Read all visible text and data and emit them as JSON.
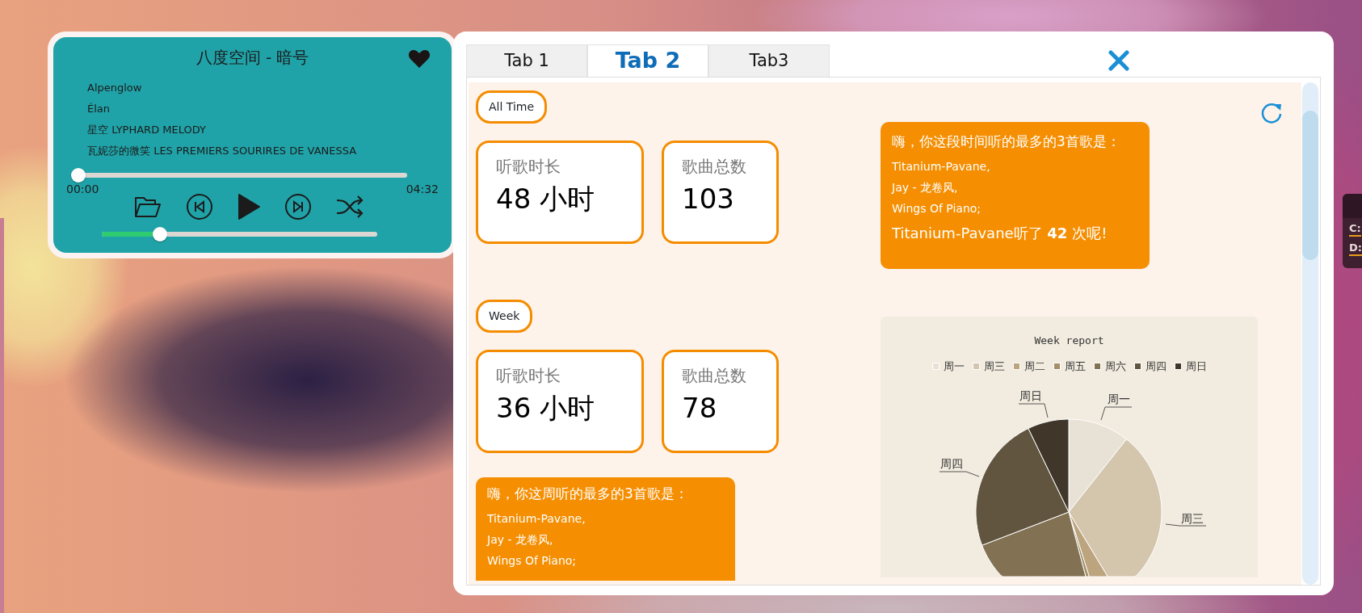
{
  "player": {
    "title": "八度空间 - 暗号",
    "liked": true,
    "playlist": [
      "Alpenglow",
      "Élan",
      "星空 LYPHARD MELODY",
      "瓦妮莎的微笑 LES PREMIERS SOURIRES DE VANESSA"
    ],
    "progress": {
      "level": 0
    },
    "elapsed": "00:00",
    "duration": "04:32",
    "playing": false,
    "volume": {
      "level": 0.21
    }
  },
  "window": {
    "tabs": [
      {
        "label": "Tab 1",
        "selected": false
      },
      {
        "label": "Tab 2",
        "selected": true
      },
      {
        "label": "Tab3",
        "selected": false
      }
    ]
  },
  "sections": [
    {
      "label": "All Time",
      "cards": [
        {
          "label": "听歌时长",
          "value": "48 小时"
        },
        {
          "label": "歌曲总数",
          "value": "103"
        }
      ],
      "message": {
        "heading": "嗨，你这段时间听的最多的3首歌是：",
        "songs": [
          "Titanium-Pavane,",
          "Jay - 龙卷风,",
          "Wings Of Piano;"
        ],
        "summary": "Titanium-Pavane听了 **42** 次呢!"
      }
    },
    {
      "label": "Week",
      "cards": [
        {
          "label": "听歌时长",
          "value": "36 小时"
        },
        {
          "label": "歌曲总数",
          "value": "78"
        }
      ],
      "message": {
        "heading": "嗨，你这周听的最多的3首歌是：",
        "songs": [
          "Titanium-Pavane,",
          "Jay - 龙卷风,",
          "Wings Of Piano;"
        ]
      },
      "chart": {
        "title": "Week report",
        "legend": [
          {
            "label": "周一",
            "color": "#e8e2d6"
          },
          {
            "label": "周三",
            "color": "#d4c5ad"
          },
          {
            "label": "周二",
            "color": "#bca47e"
          },
          {
            "label": "周五",
            "color": "#a38f68"
          },
          {
            "label": "周六",
            "color": "#827152"
          },
          {
            "label": "周四",
            "color": "#61553f"
          },
          {
            "label": "周日",
            "color": "#40372a"
          }
        ],
        "slice_labels": [
          "周日",
          "周一",
          "周四",
          "周三"
        ]
      }
    }
  ],
  "desktop_widget": {
    "drives": [
      "C:",
      "D:"
    ]
  }
}
